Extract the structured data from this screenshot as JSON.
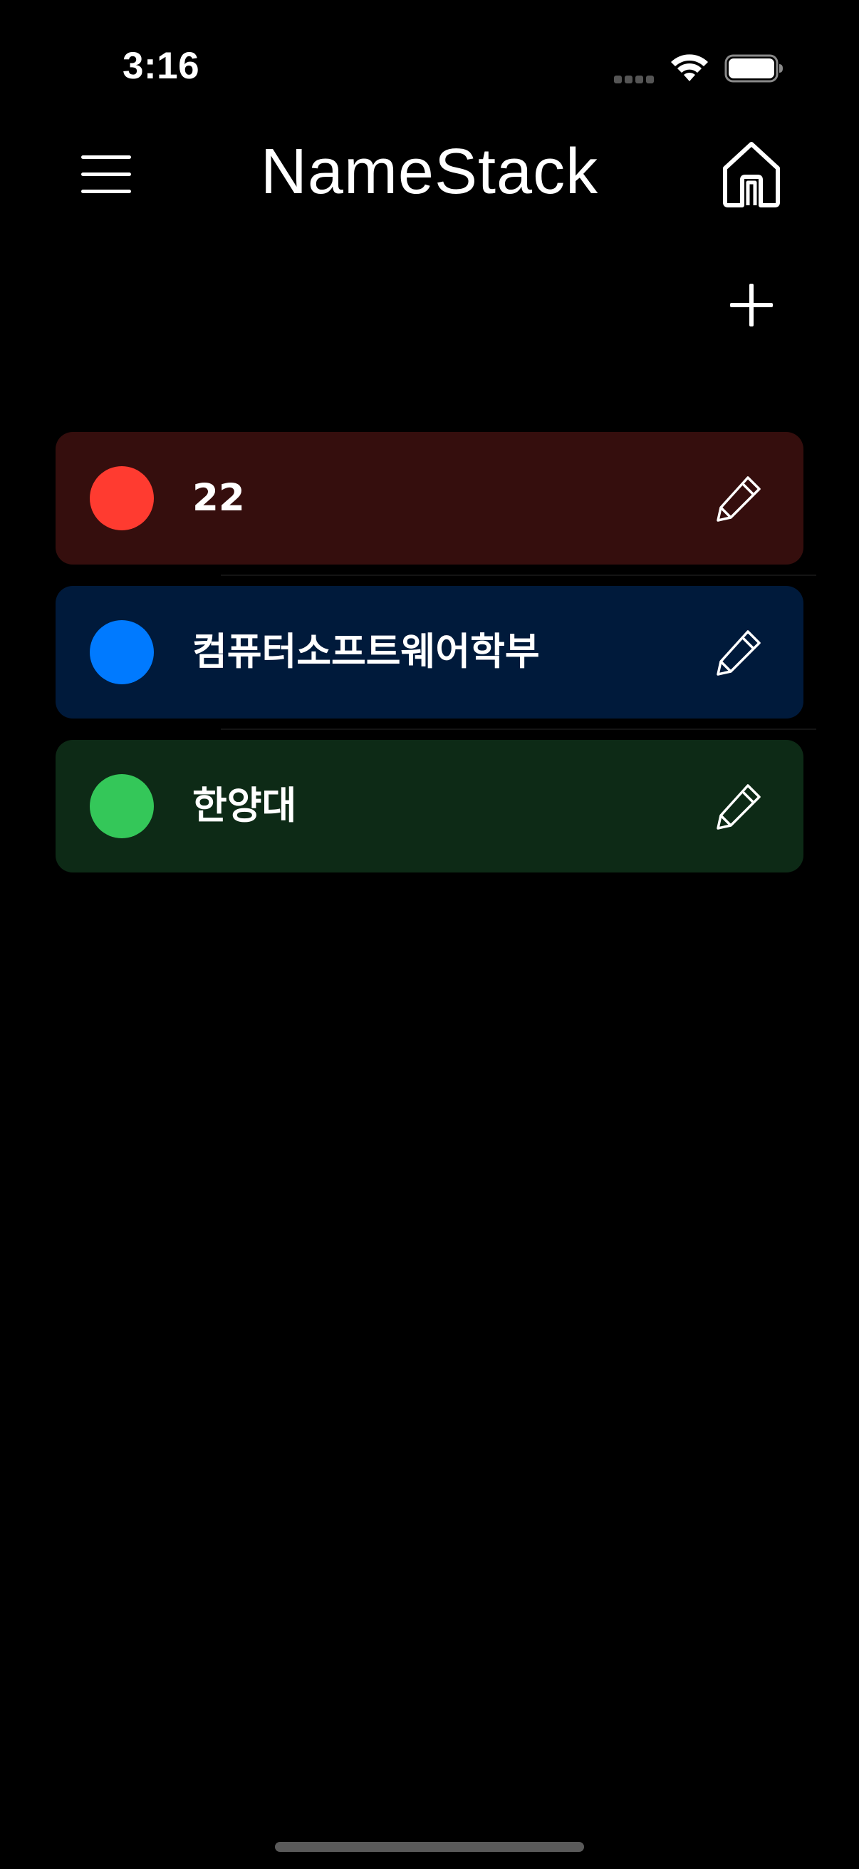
{
  "status_bar": {
    "time": "3:16"
  },
  "header": {
    "title": "NameStack",
    "menu_icon": "hamburger-menu-icon",
    "home_icon": "home-icon",
    "add_icon": "plus-icon"
  },
  "items": [
    {
      "label": "22",
      "color": "#ff3b30",
      "background": "#350e0d",
      "icon": "pencil-icon"
    },
    {
      "label": "컴퓨터소프트웨어학부",
      "color": "#007aff",
      "background": "#001a3b",
      "icon": "pencil-icon"
    },
    {
      "label": "한양대",
      "color": "#34c759",
      "background": "#0d2a16",
      "icon": "pencil-icon"
    }
  ]
}
